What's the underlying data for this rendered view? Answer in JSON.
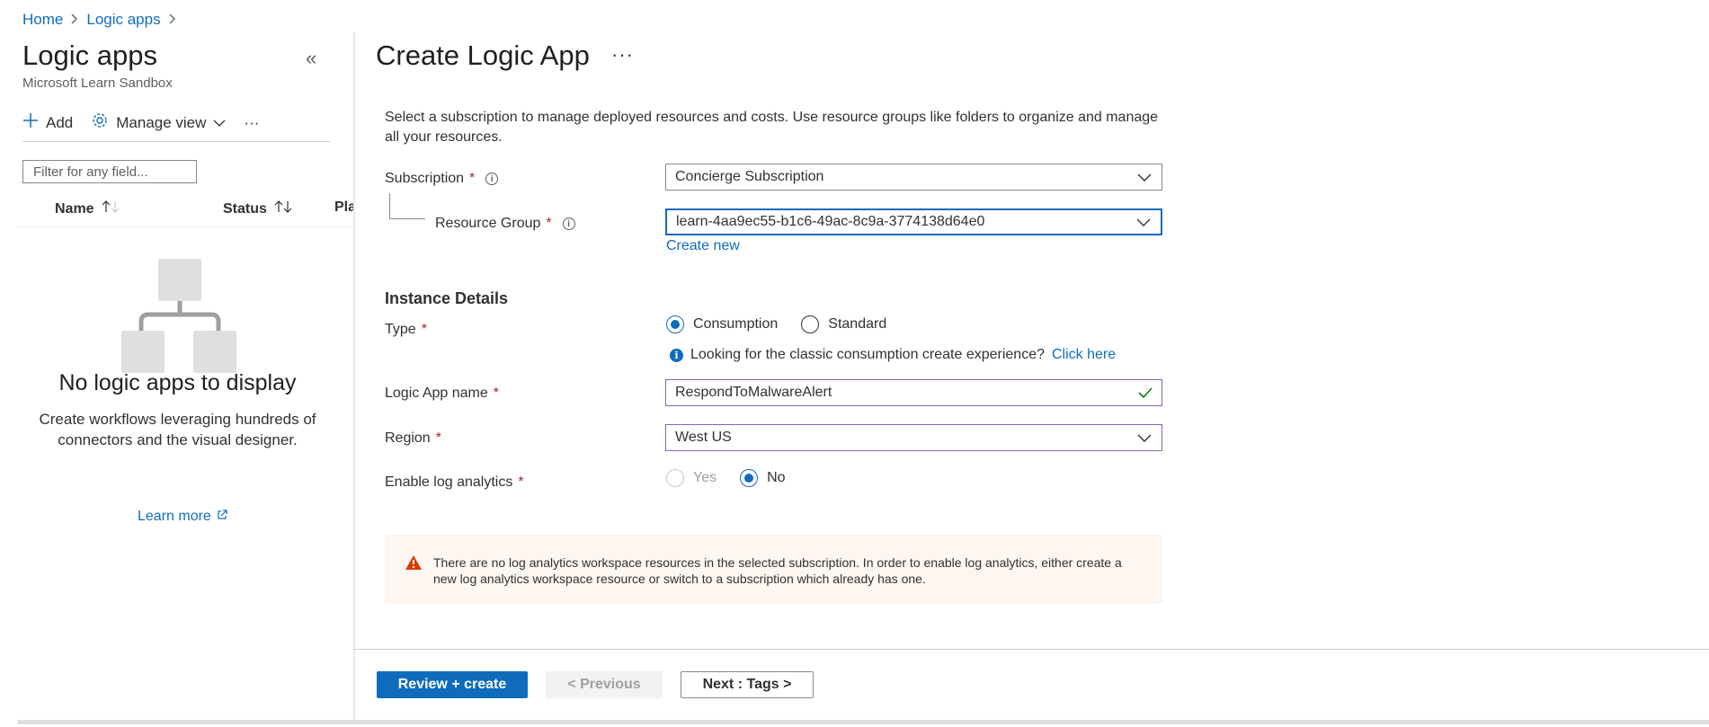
{
  "breadcrumb": {
    "home": "Home",
    "logic_apps": "Logic apps",
    "sep": ">"
  },
  "left": {
    "title": "Logic apps",
    "subtitle": "Microsoft Learn Sandbox",
    "collapse": "«",
    "toolbar": {
      "add": "Add",
      "manage_view": "Manage view",
      "more": "···"
    },
    "filter_placeholder": "Filter for any field...",
    "columns": {
      "name": "Name",
      "status": "Status",
      "plan": "Plan"
    },
    "empty_title": "No logic apps to display",
    "empty_desc": "Create workflows leveraging hundreds of connectors and the visual designer.",
    "learn_more": "Learn more"
  },
  "form": {
    "title": "Create Logic App",
    "more": "···",
    "intro": "Select a subscription to manage deployed resources and costs. Use resource groups like folders to organize and manage all your resources.",
    "required_mark": "*",
    "subscription_label": "Subscription",
    "subscription_value": "Concierge Subscription",
    "resource_group_label": "Resource Group",
    "resource_group_value": "learn-4aa9ec55-b1c6-49ac-8c9a-3774138d64e0",
    "create_new": "Create new",
    "instance_details": "Instance Details",
    "type_label": "Type",
    "type_options": {
      "consumption": "Consumption",
      "standard": "Standard"
    },
    "type_selected": "Consumption",
    "classic_text": "Looking for the classic consumption create experience?",
    "classic_link": "Click here",
    "name_label": "Logic App name",
    "name_value": "RespondToMalwareAlert",
    "region_label": "Region",
    "region_value": "West US",
    "log_label": "Enable log analytics",
    "log_options": {
      "yes": "Yes",
      "no": "No"
    },
    "log_selected": "No",
    "warning": "There are no log analytics workspace resources in the selected subscription. In order to enable log analytics, either create a new log analytics workspace resource or switch to a subscription which already has one."
  },
  "footer": {
    "review_create": "Review + create",
    "previous": "< Previous",
    "next": "Next : Tags >"
  },
  "colors": {
    "accent": "#0f6cbd",
    "required": "#a4262c",
    "valid": "#107c10",
    "warning": "#d83b01",
    "warning_bg": "#fdf6f1"
  }
}
